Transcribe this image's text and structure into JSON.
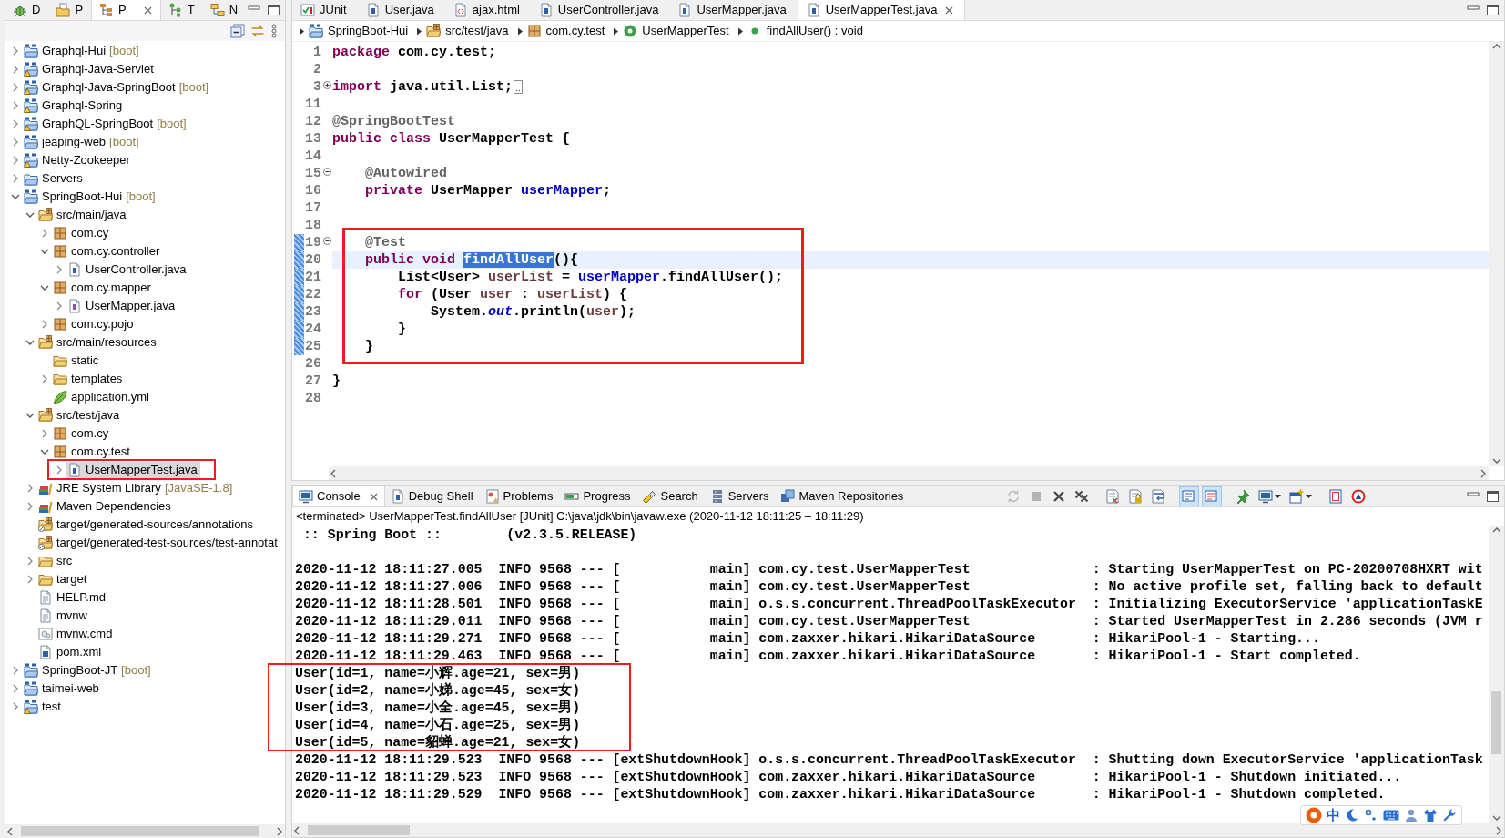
{
  "explorer": {
    "tabs": [
      {
        "label": "D",
        "kind": "debug",
        "selected": false
      },
      {
        "label": "P",
        "kind": "packages",
        "selected": false
      },
      {
        "label": "P",
        "kind": "projects",
        "selected": true
      },
      {
        "label": "T",
        "kind": "hierarchy",
        "selected": false
      },
      {
        "label": "N",
        "kind": "navigator",
        "selected": false
      }
    ],
    "tree": [
      {
        "label": "Graphql-Hui",
        "decoration": "[boot]",
        "kind": "maven-project",
        "warning": false,
        "expanded": false,
        "selected": false
      },
      {
        "label": "Graphql-Java-Servlet",
        "kind": "maven-project",
        "warning": true,
        "expanded": false,
        "selected": false
      },
      {
        "label": "Graphql-Java-SpringBoot",
        "decoration": "[boot]",
        "kind": "maven-project",
        "warning": true,
        "expanded": false,
        "selected": false
      },
      {
        "label": "Graphql-Spring",
        "kind": "maven-project",
        "warning": true,
        "expanded": false,
        "selected": false
      },
      {
        "label": "GraphQL-SpringBoot",
        "decoration": "[boot]",
        "kind": "maven-project",
        "warning": true,
        "expanded": false,
        "selected": false
      },
      {
        "label": "jeaping-web",
        "decoration": "[boot]",
        "kind": "maven-project",
        "warning": false,
        "expanded": false,
        "selected": false
      },
      {
        "label": "Netty-Zookeeper",
        "kind": "maven-project",
        "warning": true,
        "expanded": false,
        "selected": false
      },
      {
        "label": "Servers",
        "kind": "project",
        "warning": false,
        "expanded": false,
        "selected": false
      },
      {
        "label": "SpringBoot-Hui",
        "decoration": "[boot]",
        "kind": "maven-project",
        "warning": false,
        "expanded": true,
        "selected": false,
        "children": [
          {
            "label": "src/main/java",
            "kind": "source-folder",
            "expanded": true,
            "selected": false,
            "children": [
              {
                "label": "com.cy",
                "kind": "package",
                "expanded": false,
                "selected": false
              },
              {
                "label": "com.cy.controller",
                "kind": "package",
                "expanded": true,
                "selected": false,
                "children": [
                  {
                    "label": "UserController.java",
                    "kind": "java",
                    "expanded": false,
                    "selected": false
                  }
                ]
              },
              {
                "label": "com.cy.mapper",
                "kind": "package",
                "expanded": true,
                "selected": false,
                "children": [
                  {
                    "label": "UserMapper.java",
                    "kind": "interface",
                    "expanded": false,
                    "selected": false
                  }
                ]
              },
              {
                "label": "com.cy.pojo",
                "kind": "package",
                "expanded": false,
                "selected": false
              }
            ]
          },
          {
            "label": "src/main/resources",
            "kind": "source-folder",
            "expanded": true,
            "selected": false,
            "children": [
              {
                "label": "static",
                "kind": "folder",
                "selected": false
              },
              {
                "label": "templates",
                "kind": "folder",
                "expanded": false,
                "selected": false
              },
              {
                "label": "application.yml",
                "kind": "yaml",
                "selected": false
              }
            ]
          },
          {
            "label": "src/test/java",
            "kind": "source-folder",
            "expanded": true,
            "selected": false,
            "children": [
              {
                "label": "com.cy",
                "kind": "package",
                "expanded": false,
                "selected": false
              },
              {
                "label": "com.cy.test",
                "kind": "package",
                "expanded": true,
                "selected": false,
                "children": [
                  {
                    "label": "UserMapperTest.java",
                    "kind": "java",
                    "expanded": false,
                    "selected": true
                  }
                ]
              }
            ]
          },
          {
            "label": "JRE System Library",
            "decoration": "[JavaSE-1.8]",
            "kind": "library",
            "expanded": false,
            "selected": false
          },
          {
            "label": "Maven Dependencies",
            "kind": "library",
            "expanded": false,
            "selected": false
          },
          {
            "label": "target/generated-sources/annotations",
            "kind": "generated-folder",
            "selected": false
          },
          {
            "label": "target/generated-test-sources/test-annotat",
            "kind": "generated-folder",
            "selected": false
          },
          {
            "label": "src",
            "kind": "folder",
            "expanded": false,
            "selected": false
          },
          {
            "label": "target",
            "kind": "folder",
            "expanded": false,
            "selected": false
          },
          {
            "label": "HELP.md",
            "kind": "text",
            "selected": false
          },
          {
            "label": "mvnw",
            "kind": "text",
            "selected": false
          },
          {
            "label": "mvnw.cmd",
            "kind": "script",
            "selected": false
          },
          {
            "label": "pom.xml",
            "kind": "pom",
            "selected": false
          }
        ]
      },
      {
        "label": "SpringBoot-JT",
        "decoration": "[boot]",
        "kind": "maven-project",
        "warning": false,
        "expanded": false,
        "selected": false
      },
      {
        "label": "taimei-web",
        "kind": "maven-project",
        "warning": false,
        "expanded": false,
        "selected": false
      },
      {
        "label": "test",
        "kind": "maven-project",
        "warning": true,
        "expanded": false,
        "selected": false
      }
    ]
  },
  "editor": {
    "tabs": [
      {
        "label": "JUnit",
        "kind": "junit",
        "selected": false
      },
      {
        "label": "User.java",
        "kind": "java",
        "selected": false
      },
      {
        "label": "ajax.html",
        "kind": "html",
        "selected": false
      },
      {
        "label": "UserController.java",
        "kind": "java",
        "selected": false
      },
      {
        "label": "UserMapper.java",
        "kind": "java",
        "selected": false
      },
      {
        "label": "UserMapperTest.java",
        "kind": "java",
        "selected": true
      }
    ],
    "breadcrumb": [
      {
        "label": "SpringBoot-Hui",
        "kind": "maven-project"
      },
      {
        "label": "src/test/java",
        "kind": "source-folder"
      },
      {
        "label": "com.cy.test",
        "kind": "package"
      },
      {
        "label": "UserMapperTest",
        "kind": "class"
      },
      {
        "label": "findAllUser() : void",
        "kind": "method"
      }
    ],
    "lines": [
      {
        "number": "1",
        "current": false,
        "in_range": false,
        "tokens": [
          {
            "kind": "keyword",
            "text": "package"
          },
          {
            "kind": "plain",
            "text": " com.cy.test;"
          }
        ]
      },
      {
        "number": "2",
        "current": false,
        "in_range": false
      },
      {
        "number": "3",
        "current": false,
        "in_range": false,
        "collapsed": true,
        "tokens": [
          {
            "kind": "keyword",
            "text": "import"
          },
          {
            "kind": "plain",
            "text": " java.util.List;"
          }
        ]
      },
      {
        "number": "11",
        "current": false,
        "in_range": false
      },
      {
        "number": "12",
        "current": false,
        "in_range": false,
        "tokens": [
          {
            "kind": "annotation",
            "text": "@SpringBootTest"
          }
        ]
      },
      {
        "number": "13",
        "current": false,
        "in_range": false,
        "tokens": [
          {
            "kind": "keyword",
            "text": "public class"
          },
          {
            "kind": "plain",
            "text": " UserMapperTest {"
          }
        ]
      },
      {
        "number": "14",
        "current": false,
        "in_range": false
      },
      {
        "number": "15",
        "current": false,
        "in_range": false,
        "collapsed": false,
        "tokens": [
          {
            "kind": "annotation",
            "text": "    @Autowired"
          }
        ]
      },
      {
        "number": "16",
        "current": false,
        "in_range": false,
        "tokens": [
          {
            "kind": "keyword",
            "text": "    private"
          },
          {
            "kind": "plain",
            "text": " UserMapper "
          },
          {
            "kind": "field",
            "text": "userMapper"
          },
          {
            "kind": "plain",
            "text": ";"
          }
        ]
      },
      {
        "number": "17",
        "current": false,
        "in_range": false
      },
      {
        "number": "18",
        "current": false,
        "in_range": false
      },
      {
        "number": "19",
        "current": false,
        "in_range": true,
        "collapsed": false,
        "tokens": [
          {
            "kind": "annotation",
            "text": "    @Test"
          }
        ]
      },
      {
        "number": "20",
        "current": true,
        "in_range": true,
        "tokens": [
          {
            "kind": "keyword",
            "text": "    public void "
          },
          {
            "kind": "selection",
            "text": "findAllUser"
          },
          {
            "kind": "plain",
            "text": "(){"
          }
        ]
      },
      {
        "number": "21",
        "current": false,
        "in_range": true,
        "tokens": [
          {
            "kind": "plain",
            "text": "        List<User> "
          },
          {
            "kind": "local",
            "text": "userList"
          },
          {
            "kind": "plain",
            "text": " = "
          },
          {
            "kind": "field",
            "text": "userMapper"
          },
          {
            "kind": "plain",
            "text": ".findAllUser();"
          }
        ]
      },
      {
        "number": "22",
        "current": false,
        "in_range": true,
        "tokens": [
          {
            "kind": "keyword",
            "text": "        for"
          },
          {
            "kind": "plain",
            "text": " (User "
          },
          {
            "kind": "local",
            "text": "user"
          },
          {
            "kind": "plain",
            "text": " : "
          },
          {
            "kind": "local",
            "text": "userList"
          },
          {
            "kind": "plain",
            "text": ") {"
          }
        ]
      },
      {
        "number": "23",
        "current": false,
        "in_range": true,
        "tokens": [
          {
            "kind": "plain",
            "text": "            System."
          },
          {
            "kind": "static",
            "text": "out"
          },
          {
            "kind": "plain",
            "text": ".println("
          },
          {
            "kind": "local",
            "text": "user"
          },
          {
            "kind": "plain",
            "text": ");"
          }
        ]
      },
      {
        "number": "24",
        "current": false,
        "in_range": true,
        "tokens": [
          {
            "kind": "plain",
            "text": "        }"
          }
        ]
      },
      {
        "number": "25",
        "current": false,
        "in_range": true,
        "tokens": [
          {
            "kind": "plain",
            "text": "    }"
          }
        ]
      },
      {
        "number": "26",
        "current": false,
        "in_range": false
      },
      {
        "number": "27",
        "current": false,
        "in_range": false,
        "tokens": [
          {
            "kind": "plain",
            "text": "}"
          }
        ]
      },
      {
        "number": "28",
        "current": false,
        "in_range": false
      }
    ]
  },
  "console": {
    "tabs": [
      {
        "label": "Console",
        "kind": "console",
        "selected": true
      },
      {
        "label": "Debug Shell",
        "kind": "shell",
        "selected": false
      },
      {
        "label": "Problems",
        "kind": "problems",
        "selected": false
      },
      {
        "label": "Progress",
        "kind": "progress",
        "selected": false
      },
      {
        "label": "Search",
        "kind": "search",
        "selected": false
      },
      {
        "label": "Servers",
        "kind": "servers",
        "selected": false
      },
      {
        "label": "Maven Repositories",
        "kind": "repositories",
        "selected": false
      }
    ],
    "toolbar": [
      [
        {
          "kind": "sync",
          "disabled": true,
          "pressed": false
        },
        {
          "kind": "stop",
          "disabled": true,
          "pressed": false
        },
        {
          "kind": "remove",
          "disabled": false,
          "pressed": false
        },
        {
          "kind": "remove-all",
          "disabled": false,
          "pressed": false
        }
      ],
      [
        {
          "kind": "clear",
          "disabled": false,
          "pressed": false
        },
        {
          "kind": "scroll-lock",
          "disabled": false,
          "pressed": false
        },
        {
          "kind": "word-wrap",
          "disabled": false,
          "pressed": false
        }
      ],
      [
        {
          "kind": "stdout",
          "disabled": false,
          "pressed": true
        },
        {
          "kind": "stderr",
          "disabled": false,
          "pressed": true
        }
      ],
      [
        {
          "kind": "pin",
          "disabled": false,
          "pressed": false
        },
        {
          "kind": "display",
          "disabled": false,
          "pressed": false
        },
        {
          "kind": "open",
          "disabled": false,
          "pressed": false
        }
      ],
      [
        {
          "kind": "frame",
          "disabled": false,
          "pressed": false
        },
        {
          "kind": "ant",
          "disabled": false,
          "pressed": false
        }
      ]
    ],
    "header": "<terminated> UserMapperTest.findAllUser [JUnit] C:\\java\\jdk\\bin\\javaw.exe  (2020-11-12 18:11:25 – 18:11:29)",
    "banner": " :: Spring Boot ::        (v2.3.5.RELEASE)",
    "lines": [
      "2020-11-12 18:11:27.005  INFO 9568 --- [           main] com.cy.test.UserMapperTest               : Starting UserMapperTest on PC-20200708HXRT wit",
      "2020-11-12 18:11:27.006  INFO 9568 --- [           main] com.cy.test.UserMapperTest               : No active profile set, falling back to default",
      "2020-11-12 18:11:28.501  INFO 9568 --- [           main] o.s.s.concurrent.ThreadPoolTaskExecutor  : Initializing ExecutorService 'applicationTaskE",
      "2020-11-12 18:11:29.011  INFO 9568 --- [           main] com.cy.test.UserMapperTest               : Started UserMapperTest in 2.286 seconds (JVM r",
      "2020-11-12 18:11:29.271  INFO 9568 --- [           main] com.zaxxer.hikari.HikariDataSource       : HikariPool-1 - Starting...",
      "2020-11-12 18:11:29.463  INFO 9568 --- [           main] com.zaxxer.hikari.HikariDataSource       : HikariPool-1 - Start completed.",
      "User(id=1, name=小辉.age=21, sex=男)",
      "User(id=2, name=小娣.age=45, sex=女)",
      "User(id=3, name=小全.age=45, sex=男)",
      "User(id=4, name=小石.age=25, sex=男)",
      "User(id=5, name=貂蝉.age=21, sex=女)",
      "2020-11-12 18:11:29.523  INFO 9568 --- [extShutdownHook] o.s.s.concurrent.ThreadPoolTaskExecutor  : Shutting down ExecutorService 'applicationTask",
      "2020-11-12 18:11:29.523  INFO 9568 --- [extShutdownHook] com.zaxxer.hikari.HikariDataSource       : HikariPool-1 - Shutdown initiated...",
      "2020-11-12 18:11:29.529  INFO 9568 --- [extShutdownHook] com.zaxxer.hikari.HikariDataSource       : HikariPool-1 - Shutdown completed."
    ]
  },
  "ime_toolbar": {
    "mode": "中"
  }
}
